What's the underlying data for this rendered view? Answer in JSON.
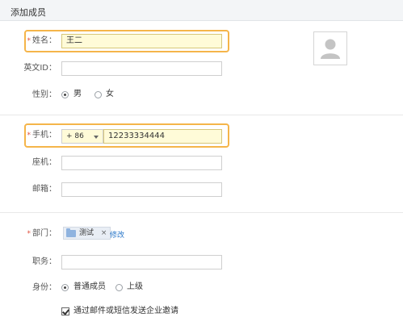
{
  "header": {
    "title": "添加成员"
  },
  "form": {
    "name": {
      "label": "姓名：",
      "value": "王二",
      "required_mark": "*"
    },
    "english_id": {
      "label": "英文ID：",
      "value": ""
    },
    "gender": {
      "label": "性别：",
      "options": [
        "男",
        "女"
      ],
      "selected": "男"
    },
    "mobile": {
      "label": "手机：",
      "required_mark": "*",
      "country_code": "+ 86",
      "value": "12233334444"
    },
    "landline": {
      "label": "座机：",
      "value": ""
    },
    "email": {
      "label": "邮箱：",
      "value": ""
    },
    "department": {
      "label": "部门：",
      "required_mark": "*",
      "tag": "测试",
      "remove": "×",
      "edit_link": "修改"
    },
    "position": {
      "label": "职务：",
      "value": ""
    },
    "identity": {
      "label": "身份：",
      "options": [
        "普通成员",
        "上级"
      ],
      "selected": "普通成员"
    },
    "invite": {
      "label": "通过邮件或短信发送企业邀请",
      "checked": true
    }
  },
  "colors": {
    "highlight": "#f5b54a",
    "filled_bg": "#fffbd8",
    "link": "#2a77c9",
    "required": "#e0503f"
  }
}
